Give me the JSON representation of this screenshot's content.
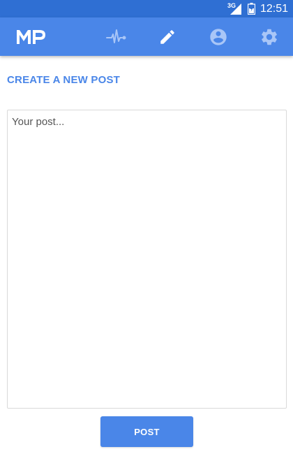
{
  "status_bar": {
    "network": "3G",
    "time": "12:51",
    "icons": [
      "signal-icon",
      "battery-icon"
    ]
  },
  "app_bar": {
    "logo_text": "MP",
    "nav": [
      {
        "id": "activity",
        "icon": "heartbeat-icon",
        "active": false
      },
      {
        "id": "create",
        "icon": "pencil-icon",
        "active": true
      },
      {
        "id": "profile",
        "icon": "account-circle-icon",
        "active": false
      },
      {
        "id": "settings",
        "icon": "gear-icon",
        "active": false
      }
    ]
  },
  "main": {
    "title": "CREATE A NEW POST",
    "post_input": {
      "value": "",
      "placeholder": "Your post..."
    },
    "post_button_label": "POST"
  },
  "colors": {
    "status_bar": "#2f6fd3",
    "primary": "#4a86e8",
    "inactive_icon": "#a9c6f7",
    "active_icon": "#ffffff"
  }
}
